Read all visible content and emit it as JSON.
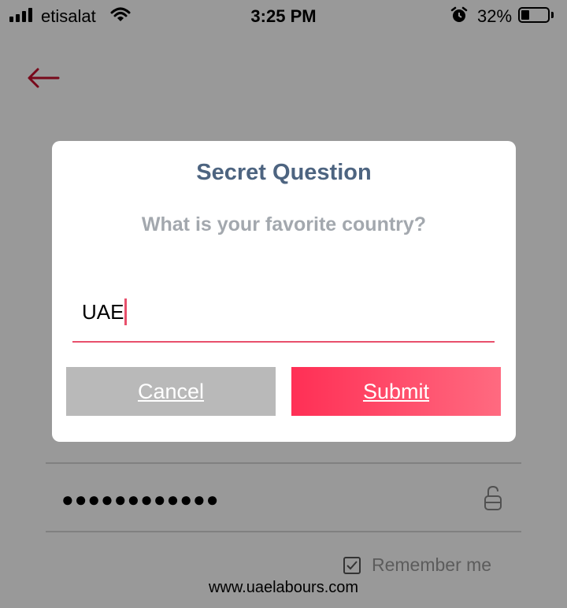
{
  "status_bar": {
    "carrier": "etisalat",
    "time": "3:25 PM",
    "battery_percent": "32%",
    "battery_level": 0.32,
    "icons": [
      "signal-icon",
      "wifi-icon",
      "alarm-icon",
      "battery-icon"
    ]
  },
  "nav": {
    "back_icon": "arrow-left-icon"
  },
  "dialog": {
    "title": "Secret Question",
    "question": "What is your favorite country?",
    "answer_value": "UAE",
    "cancel_label": "Cancel",
    "submit_label": "Submit"
  },
  "form": {
    "password_masked": "●●●●●●●●●●●●",
    "lock_icon": "lock-icon",
    "remember_label": "Remember me",
    "remember_checked": true
  },
  "watermark": "www.uaelabours.com",
  "colors": {
    "accent": "#e8506c",
    "title": "#4d6480",
    "submit_start": "#ff2f55",
    "submit_end": "#ff6a80",
    "cancel": "#b9b9b9"
  }
}
